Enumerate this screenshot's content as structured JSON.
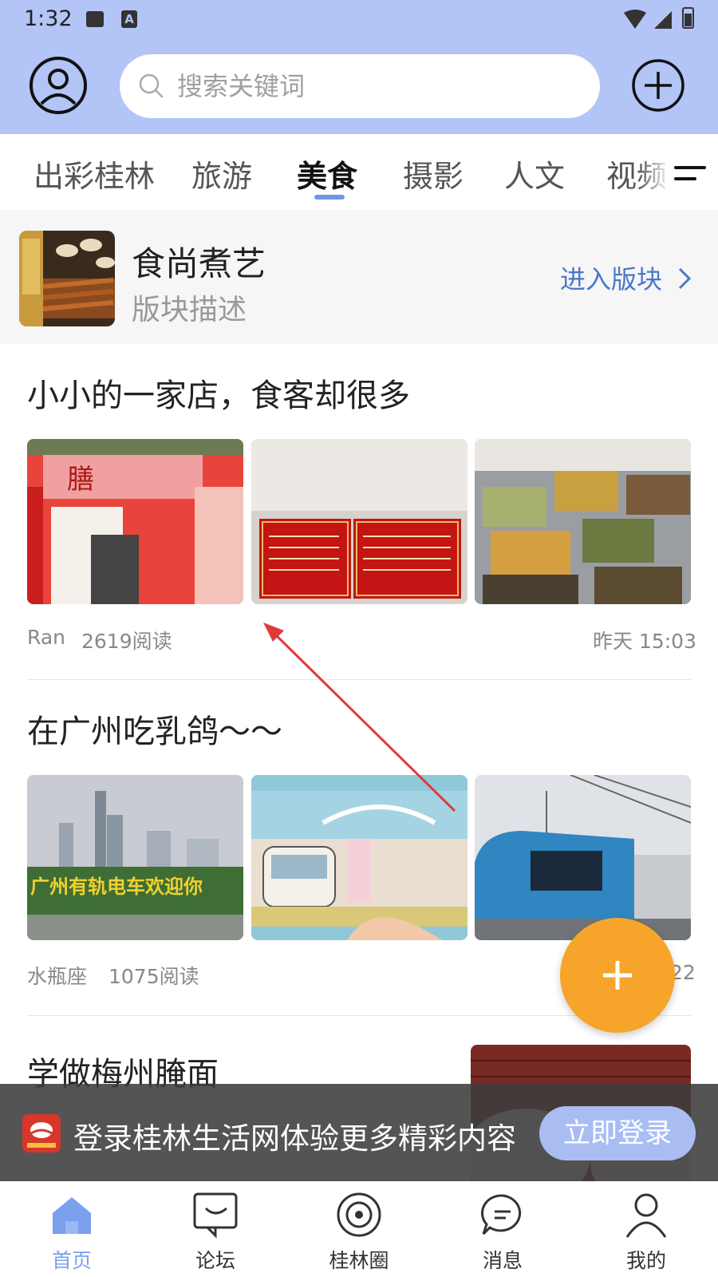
{
  "status_bar": {
    "time": "1:32",
    "app_icon_letter": "A"
  },
  "header": {
    "search_placeholder": "搜索关键词"
  },
  "tabs": [
    {
      "label": "出彩桂林",
      "active": false
    },
    {
      "label": "旅游",
      "active": false
    },
    {
      "label": "美食",
      "active": true
    },
    {
      "label": "摄影",
      "active": false
    },
    {
      "label": "人文",
      "active": false
    },
    {
      "label": "视频",
      "active": false
    }
  ],
  "section": {
    "title": "食尚煮艺",
    "description": "版块描述",
    "enter_label": "进入版块"
  },
  "posts": [
    {
      "title": "小小的一家店，食客却很多",
      "author": "Ran",
      "reads": "2619阅读",
      "time": "昨天 15:03"
    },
    {
      "title": "在广州吃乳鸽〜〜",
      "author": "水瓶座",
      "reads": "1075阅读",
      "time": "22"
    },
    {
      "title": "学做梅州腌面"
    }
  ],
  "login_banner": {
    "text": "登录桂林生活网体验更多精彩内容",
    "button": "立即登录"
  },
  "bottom_nav": [
    {
      "label": "首页",
      "icon": "home-icon",
      "active": true
    },
    {
      "label": "论坛",
      "icon": "forum-icon",
      "active": false
    },
    {
      "label": "桂林圈",
      "icon": "circle-icon",
      "active": false
    },
    {
      "label": "消息",
      "icon": "message-icon",
      "active": false
    },
    {
      "label": "我的",
      "icon": "profile-icon",
      "active": false
    }
  ],
  "colors": {
    "header_bg": "#b3c4f7",
    "accent": "#6f95e8",
    "fab": "#f6a52a",
    "link": "#4a78c8"
  }
}
